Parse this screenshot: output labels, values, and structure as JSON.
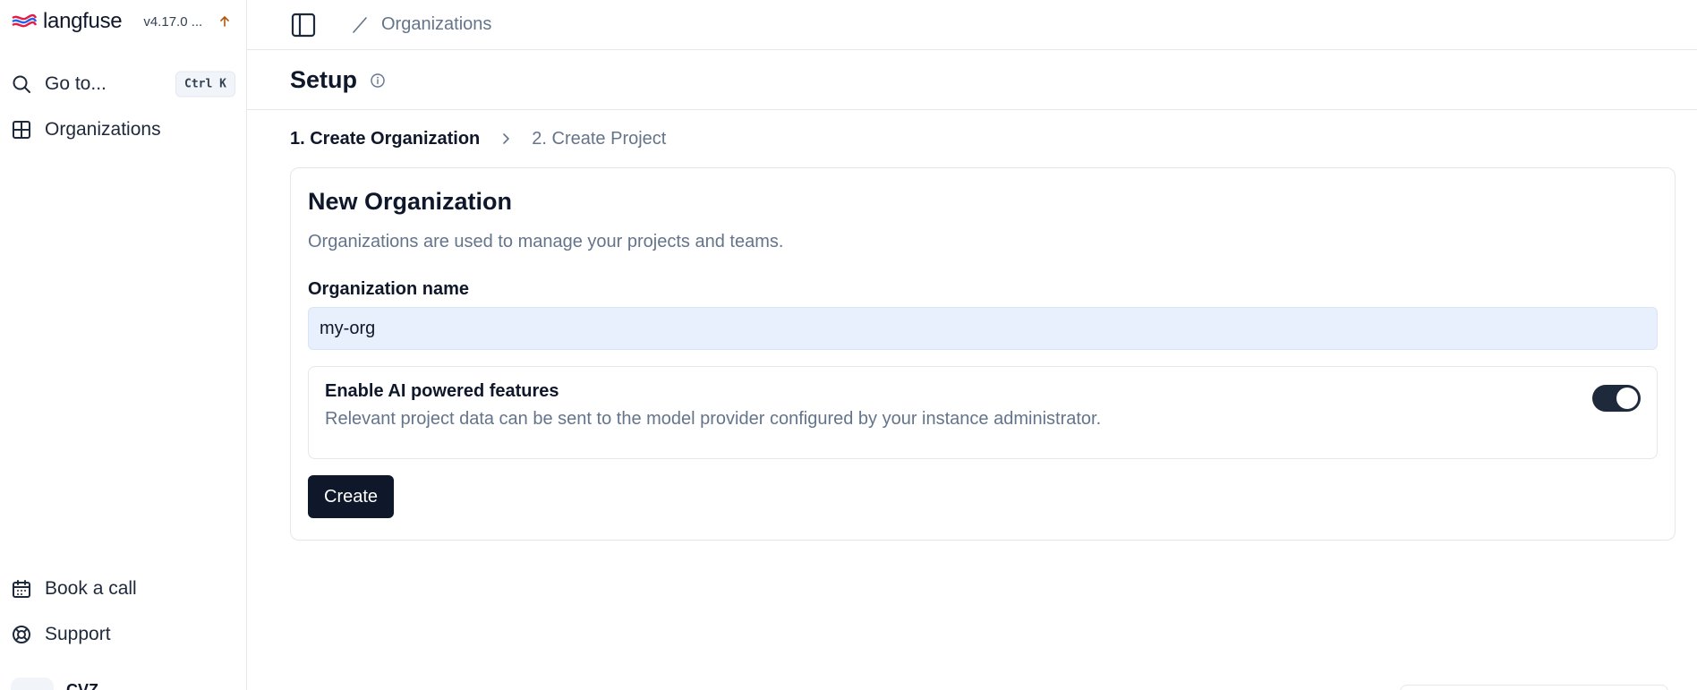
{
  "brand": {
    "name": "langfuse",
    "version": "v4.17.0 ..."
  },
  "sidebar": {
    "search": {
      "label": "Go to...",
      "shortcut": "Ctrl K"
    },
    "items": [
      {
        "label": "Organizations",
        "icon": "grid-icon"
      }
    ],
    "bottom_items": [
      {
        "label": "Book a call",
        "icon": "calendar-icon"
      },
      {
        "label": "Support",
        "icon": "lifebuoy-icon"
      }
    ],
    "user": {
      "name": "CVZ"
    }
  },
  "header": {
    "breadcrumb": "Organizations"
  },
  "page": {
    "title": "Setup",
    "steps": [
      {
        "label": "1. Create Organization",
        "active": true
      },
      {
        "label": "2. Create Project",
        "active": false
      }
    ]
  },
  "form": {
    "title": "New Organization",
    "description": "Organizations are used to manage your projects and teams.",
    "name_label": "Organization name",
    "name_value": "my-org",
    "ai_toggle": {
      "title": "Enable AI powered features",
      "description": "Relevant project data can be sent to the model provider configured by your instance administrator.",
      "enabled": true
    },
    "submit_label": "Create"
  },
  "colors": {
    "primary": "#0f172a",
    "muted_text": "#64748b",
    "input_bg": "#e8effd",
    "border": "#e5e7eb"
  }
}
